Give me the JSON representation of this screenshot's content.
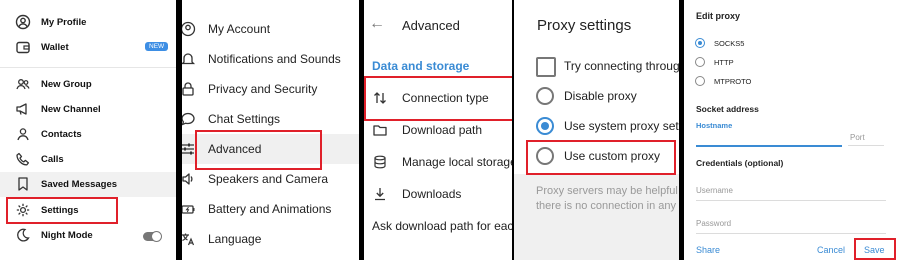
{
  "colors": {
    "accent": "#3a8bd4",
    "highlight": "#e0202a",
    "badge": "#3d8ee4"
  },
  "menu": {
    "items": [
      {
        "label": "My Profile",
        "icon": "profile-icon"
      },
      {
        "label": "Wallet",
        "icon": "wallet-icon",
        "badge": "NEW"
      },
      {
        "label": "New Group",
        "icon": "group-icon"
      },
      {
        "label": "New Channel",
        "icon": "channel-icon"
      },
      {
        "label": "Contacts",
        "icon": "contacts-icon"
      },
      {
        "label": "Calls",
        "icon": "calls-icon"
      },
      {
        "label": "Saved Messages",
        "icon": "bookmark-icon"
      },
      {
        "label": "Settings",
        "icon": "gear-icon"
      },
      {
        "label": "Night Mode",
        "icon": "moon-icon"
      }
    ]
  },
  "settings": {
    "items": [
      {
        "label": "My Account",
        "icon": "account-icon"
      },
      {
        "label": "Notifications and Sounds",
        "icon": "bell-icon"
      },
      {
        "label": "Privacy and Security",
        "icon": "lock-icon"
      },
      {
        "label": "Chat Settings",
        "icon": "chat-icon"
      },
      {
        "label": "Advanced",
        "icon": "sliders-icon"
      },
      {
        "label": "Speakers and Camera",
        "icon": "speaker-icon"
      },
      {
        "label": "Battery and Animations",
        "icon": "battery-icon"
      },
      {
        "label": "Language",
        "icon": "language-icon"
      }
    ]
  },
  "advanced": {
    "title": "Advanced",
    "section": "Data and storage",
    "items": [
      {
        "label": "Connection type",
        "icon": "arrows-icon"
      },
      {
        "label": "Download path",
        "icon": "folder-icon"
      },
      {
        "label": "Manage local storage",
        "icon": "database-icon"
      },
      {
        "label": "Downloads",
        "icon": "download-icon"
      }
    ],
    "footer": "Ask download path for each file"
  },
  "proxy": {
    "title": "Proxy settings",
    "options": [
      {
        "label": "Try connecting through proxy",
        "type": "checkbox",
        "checked": false
      },
      {
        "label": "Disable proxy",
        "type": "radio",
        "checked": false
      },
      {
        "label": "Use system proxy settings",
        "type": "radio",
        "checked": true
      },
      {
        "label": "Use custom proxy",
        "type": "radio",
        "checked": false
      }
    ],
    "info_line1": "Proxy servers may be helpful",
    "info_line2": "there is no connection in any"
  },
  "edit_proxy": {
    "title": "Edit proxy",
    "types": [
      {
        "label": "SOCKS5",
        "checked": true
      },
      {
        "label": "HTTP",
        "checked": false
      },
      {
        "label": "MTPROTO",
        "checked": false
      }
    ],
    "socket_label": "Socket address",
    "hostname_label": "Hostname",
    "port_placeholder": "Port",
    "credentials_label": "Credentials (optional)",
    "username_placeholder": "Username",
    "password_placeholder": "Password",
    "share_label": "Share",
    "cancel_label": "Cancel",
    "save_label": "Save"
  }
}
